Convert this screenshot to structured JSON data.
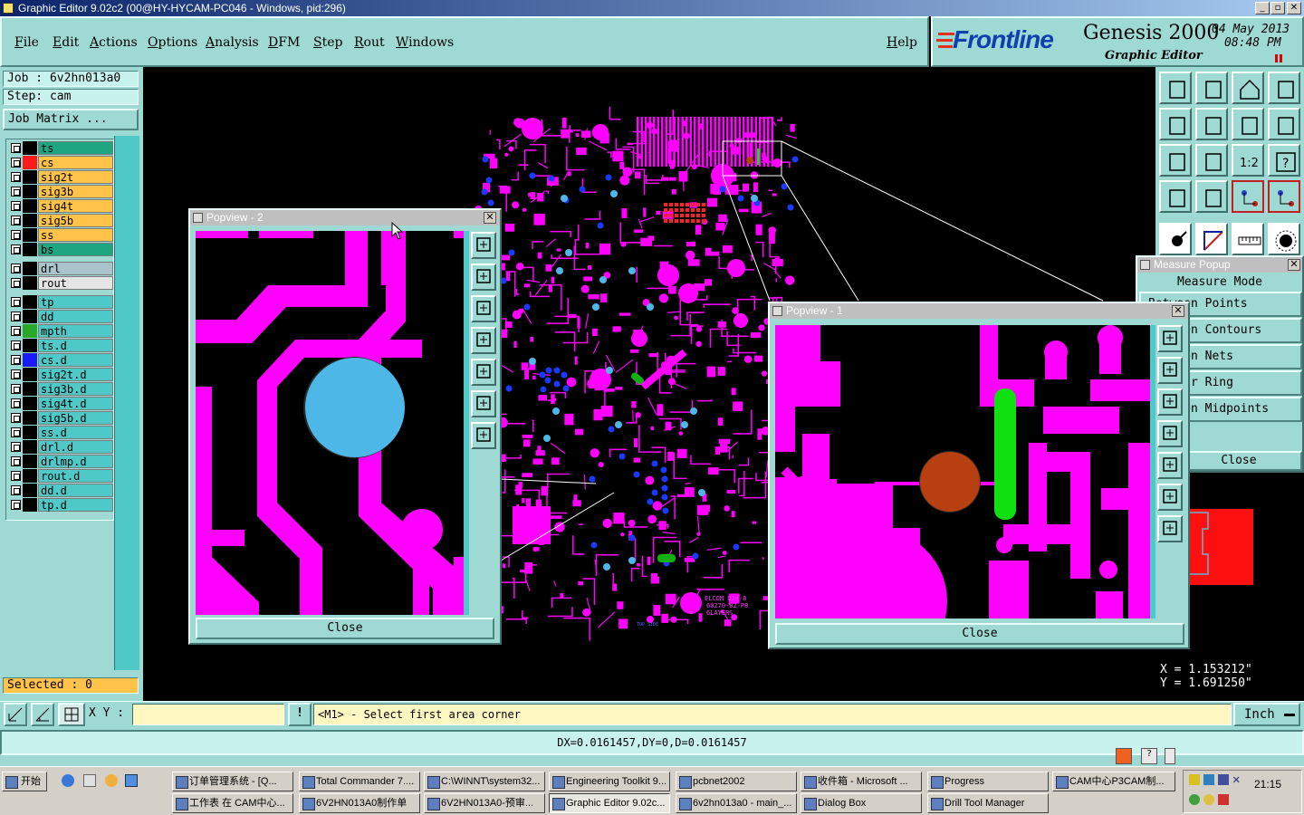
{
  "window": {
    "title": "Graphic Editor 9.02c2 (00@HY-HYCAM-PC046 - Windows, pid:296)"
  },
  "menu": [
    "File",
    "Edit",
    "Actions",
    "Options",
    "Analysis",
    "DFM",
    "Step",
    "Rout",
    "Windows"
  ],
  "help_label": "Help",
  "brand": {
    "logo": "Frontline",
    "product": "Genesis 2000",
    "subtitle": "Graphic Editor",
    "date": "04 May 2013",
    "time": "08:48 PM"
  },
  "job": {
    "job_text": "Job : 6v2hn013a0",
    "step_text": "Step: cam",
    "matrix_button": "Job Matrix ..."
  },
  "layers": [
    {
      "name": "ts",
      "bg": "#1ea582",
      "color": "#000000"
    },
    {
      "name": "cs",
      "bg": "#ffc34a",
      "color": "#ff1a1a",
      "active": true
    },
    {
      "name": "sig2t",
      "bg": "#ffc34a",
      "color": "#000000"
    },
    {
      "name": "sig3b",
      "bg": "#ffc34a",
      "color": "#000000"
    },
    {
      "name": "sig4t",
      "bg": "#ffc34a",
      "color": "#000000"
    },
    {
      "name": "sig5b",
      "bg": "#ffc34a",
      "color": "#000000"
    },
    {
      "name": "ss",
      "bg": "#ffc34a",
      "color": "#000000"
    },
    {
      "name": "bs",
      "bg": "#1ea582",
      "color": "#000000"
    },
    {
      "name": "drl",
      "bg": "#a9c4cb",
      "color": "#000000"
    },
    {
      "name": "rout",
      "bg": "#e5e5e5",
      "color": "#000000"
    },
    {
      "name": "tp",
      "bg": "#4fc8c8",
      "color": "#000000"
    },
    {
      "name": "dd",
      "bg": "#4fc8c8",
      "color": "#000000"
    },
    {
      "name": "mpth",
      "bg": "#4fc8c8",
      "color": "#2aa82a"
    },
    {
      "name": "ts.d",
      "bg": "#4fc8c8",
      "color": "#000000"
    },
    {
      "name": "cs.d",
      "bg": "#4fc8c8",
      "color": "#1a1aff"
    },
    {
      "name": "sig2t.d",
      "bg": "#4fc8c8",
      "color": "#000000"
    },
    {
      "name": "sig3b.d",
      "bg": "#4fc8c8",
      "color": "#000000"
    },
    {
      "name": "sig4t.d",
      "bg": "#4fc8c8",
      "color": "#000000"
    },
    {
      "name": "sig5b.d",
      "bg": "#4fc8c8",
      "color": "#000000"
    },
    {
      "name": "ss.d",
      "bg": "#4fc8c8",
      "color": "#000000"
    },
    {
      "name": "drl.d",
      "bg": "#4fc8c8",
      "color": "#000000"
    },
    {
      "name": "drlmp.d",
      "bg": "#4fc8c8",
      "color": "#000000"
    },
    {
      "name": "rout.d",
      "bg": "#4fc8c8",
      "color": "#000000"
    },
    {
      "name": "dd.d",
      "bg": "#4fc8c8",
      "color": "#000000"
    },
    {
      "name": "tp.d",
      "bg": "#4fc8c8",
      "color": "#000000"
    }
  ],
  "selected_text": "Selected : 0",
  "board_text": [
    "ELCOM U2e-8",
    "60270-02-P8",
    "6LAYERS",
    "TOP SIDE"
  ],
  "popview2": {
    "title": "Popview - 2",
    "close": "Close"
  },
  "popview1": {
    "title": "Popview - 1",
    "close": "Close"
  },
  "measure": {
    "title": "Measure Popup",
    "mode_label": "Measure Mode",
    "options": [
      "Between Points",
      "Between Contours",
      "Between Nets",
      "Annular Ring",
      "Between Midpoints"
    ],
    "close": "Close"
  },
  "coords": {
    "x_text": "X  = 1.153212\"",
    "y_text": "Y  = 1.691250\""
  },
  "command": {
    "xy_label": "X Y :",
    "xy_value": "",
    "prompt": "<M1> - Select first area corner",
    "units": "Inch"
  },
  "status": "DX=0.0161457,DY=0,D=0.0161457",
  "taskbar": {
    "start": "开始",
    "row1": [
      "订单管理系统 - [Q...",
      "Total Commander 7....",
      "C:\\WINNT\\system32...",
      "Engineering Toolkit 9...",
      "pcbnet2002",
      "收件箱 - Microsoft ...",
      "Progress",
      "CAM中心P3CAM制..."
    ],
    "row2": [
      "工作表 在 CAM中心...",
      "6V2HN013A0制作单",
      "6V2HN013A0-预审...",
      "Graphic Editor 9.02c...",
      "6v2hn013a0 - main_...",
      "Dialog Box",
      "Drill Tool Manager"
    ],
    "clock": "21:15"
  }
}
